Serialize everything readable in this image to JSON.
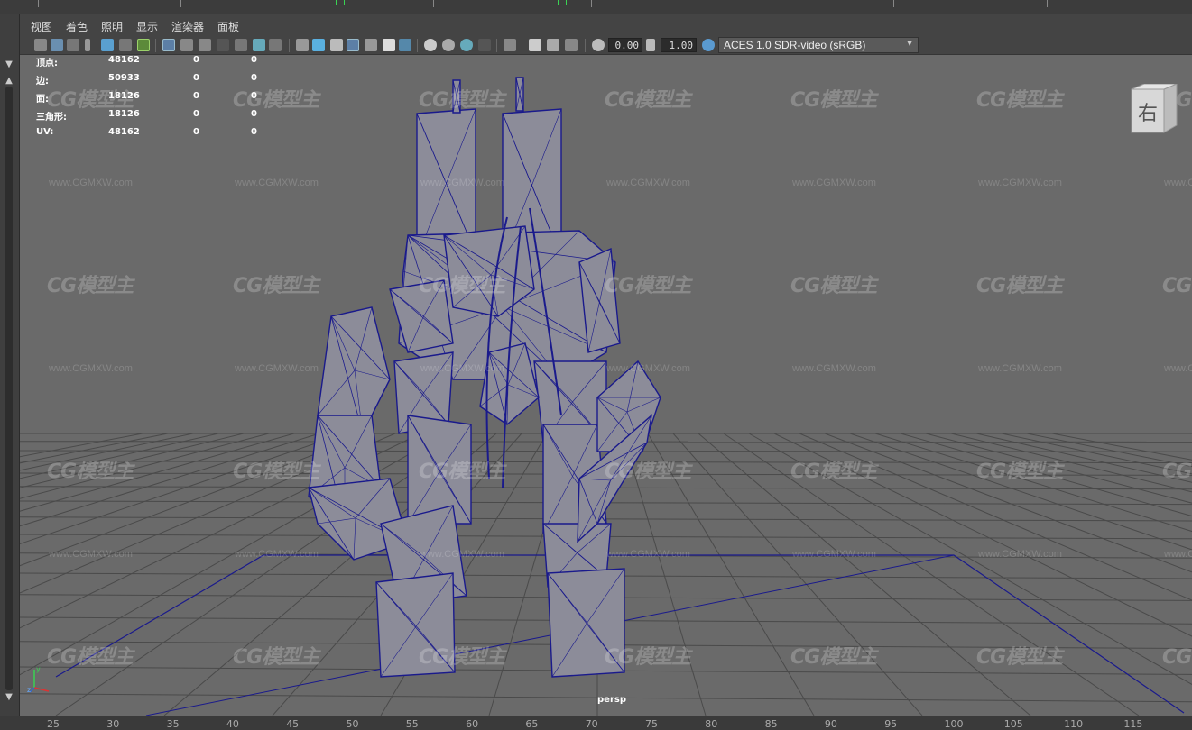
{
  "menu": {
    "items": [
      "视图",
      "着色",
      "照明",
      "显示",
      "渲染器",
      "面板"
    ]
  },
  "toolbar": {
    "exposure_value": "0.00",
    "gamma_value": "1.00",
    "color_space": "ACES 1.0 SDR-video (sRGB)"
  },
  "stats": {
    "rows": [
      {
        "label": "顶点:",
        "v1": "48162",
        "v2": "0",
        "v3": "0"
      },
      {
        "label": "边:",
        "v1": "50933",
        "v2": "0",
        "v3": "0"
      },
      {
        "label": "面:",
        "v1": "18126",
        "v2": "0",
        "v3": "0"
      },
      {
        "label": "三角形:",
        "v1": "18126",
        "v2": "0",
        "v3": "0"
      },
      {
        "label": "UV:",
        "v1": "48162",
        "v2": "0",
        "v3": "0"
      }
    ]
  },
  "view_cube": {
    "face_label": "右"
  },
  "camera_label": "persp",
  "axis_labels": {
    "x": "x",
    "y": "y",
    "z": "z"
  },
  "ruler": {
    "ticks": [
      "25",
      "30",
      "35",
      "40",
      "45",
      "50",
      "55",
      "60",
      "65",
      "70",
      "75",
      "80",
      "85",
      "90",
      "95",
      "100",
      "105",
      "110",
      "115"
    ]
  },
  "watermark": {
    "logo": "CG模型主",
    "url": "www.CGMXW.com"
  },
  "colors": {
    "viewport_bg": "#6a6a6a",
    "wireframe": "#1a1a8c",
    "mesh_fill": "#8c8c99",
    "grid": "#4a4a4a",
    "accent_green": "#39d353"
  }
}
